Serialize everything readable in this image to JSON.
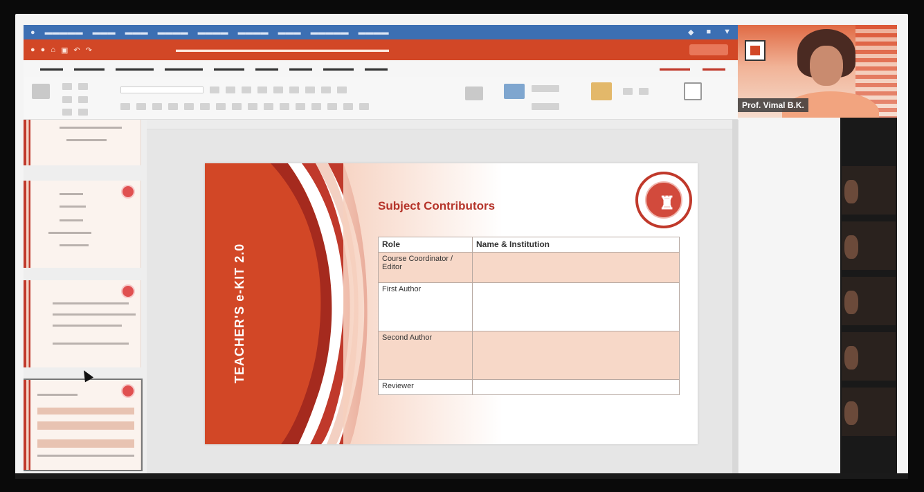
{
  "slide": {
    "vertical_title": "TEACHER'S e-KIT 2.0",
    "heading": "Subject Contributors",
    "table_header": {
      "role": "Role",
      "name": "Name & Institution"
    },
    "rows": [
      {
        "role": "Course Coordinator / Editor",
        "name": ""
      },
      {
        "role": "First Author",
        "name": ""
      },
      {
        "role": "Second Author",
        "name": ""
      },
      {
        "role": "Reviewer",
        "name": ""
      }
    ]
  },
  "video": {
    "participant_name": "Prof. Vimal B.K."
  },
  "colors": {
    "accent": "#d24726",
    "menubar": "#3c6fb3",
    "slide_red": "#c0392b",
    "peach": "#f7d8c8"
  },
  "icons": [
    "apple-icon",
    "close-icon",
    "undo-icon",
    "redo-icon",
    "search-icon",
    "shapes-icon",
    "designer-icon",
    "share-icon",
    "cursor-icon"
  ]
}
